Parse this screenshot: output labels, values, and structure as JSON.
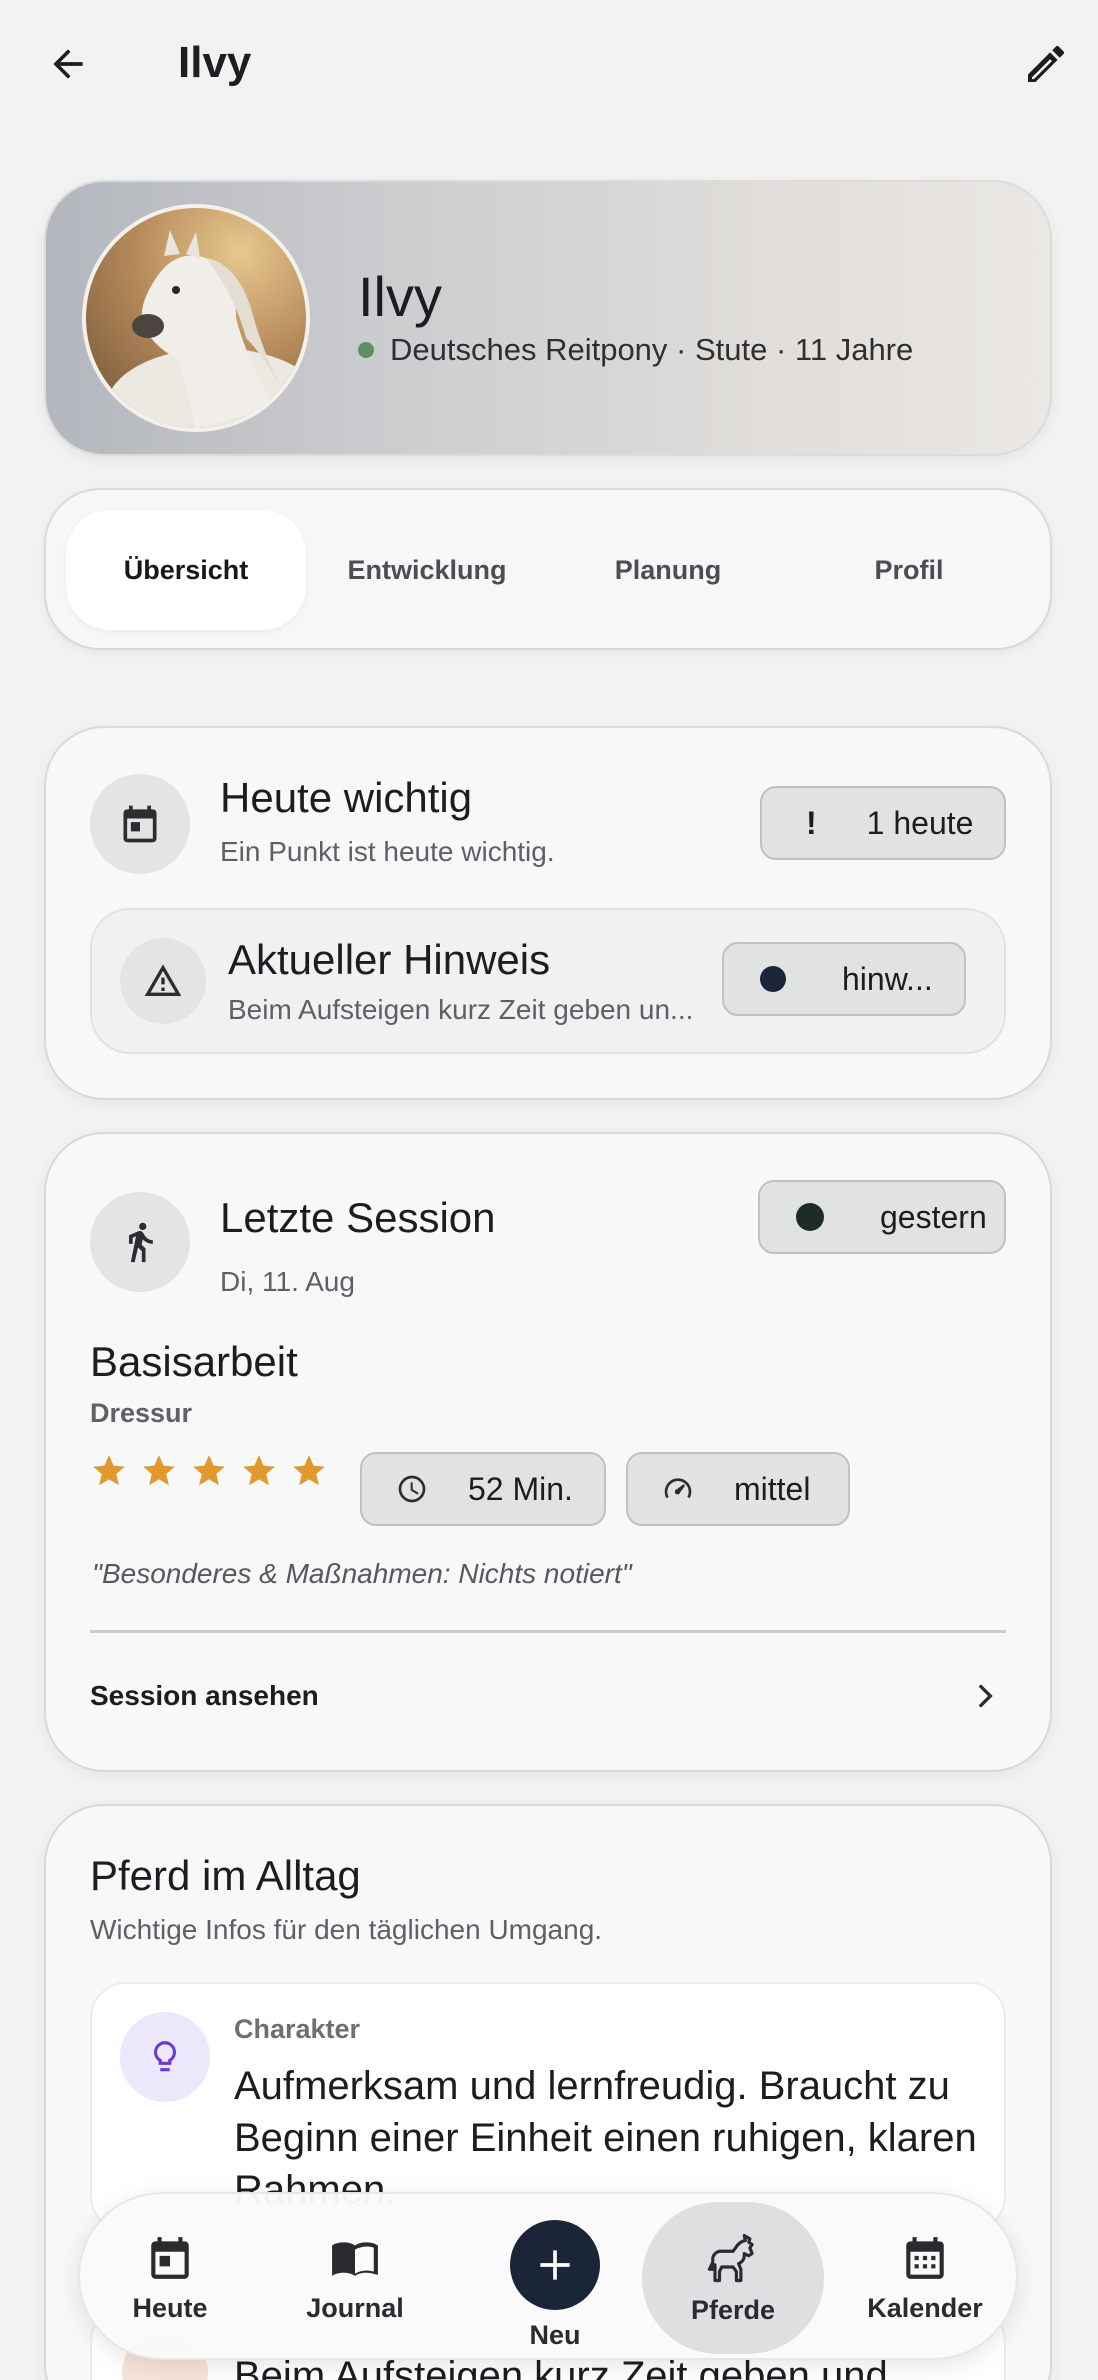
{
  "header": {
    "title": "Ilvy"
  },
  "hero": {
    "name": "Ilvy",
    "subtitle": "Deutsches Reitpony · Stute · 11 Jahre"
  },
  "tabs": [
    {
      "label": "Übersicht",
      "active": true
    },
    {
      "label": "Entwicklung",
      "active": false
    },
    {
      "label": "Planung",
      "active": false
    },
    {
      "label": "Profil",
      "active": false
    }
  ],
  "today": {
    "title": "Heute wichtig",
    "subtitle": "Ein Punkt ist heute wichtig.",
    "badge_mark": "!",
    "badge_label": "1 heute",
    "notice": {
      "title": "Aktueller Hinweis",
      "text": "Beim Aufsteigen kurz Zeit geben un...",
      "badge_label": "hinw..."
    }
  },
  "last_session": {
    "title": "Letzte Session",
    "date": "Di, 11. Aug",
    "badge_label": "gestern",
    "session_title": "Basisarbeit",
    "discipline": "Dressur",
    "rating": 5,
    "rating_max": 5,
    "duration": "52 Min.",
    "intensity": "mittel",
    "note": "\"Besonderes & Maßnahmen: Nichts notiert\"",
    "link_label": "Session ansehen"
  },
  "everyday": {
    "title": "Pferd im Alltag",
    "subtitle": "Wichtige Infos für den täglichen Umgang.",
    "character": {
      "label": "Charakter",
      "text": "Aufmerksam und lernfreudig. Braucht zu Beginn einer Einheit einen ruhigen, klaren Rahmen."
    },
    "next_text": "Beim Aufsteigen kurz Zeit geben und"
  },
  "bottom_nav": [
    {
      "label": "Heute",
      "icon": "calendar-day-icon"
    },
    {
      "label": "Journal",
      "icon": "book-icon"
    },
    {
      "label": "Neu",
      "icon": "plus-icon"
    },
    {
      "label": "Pferde",
      "icon": "horse-icon",
      "active": true
    },
    {
      "label": "Kalender",
      "icon": "calendar-grid-icon"
    }
  ],
  "colors": {
    "accent_dark": "#1a2638",
    "star": "#e0982f",
    "status_dot": "#5f8e62"
  }
}
